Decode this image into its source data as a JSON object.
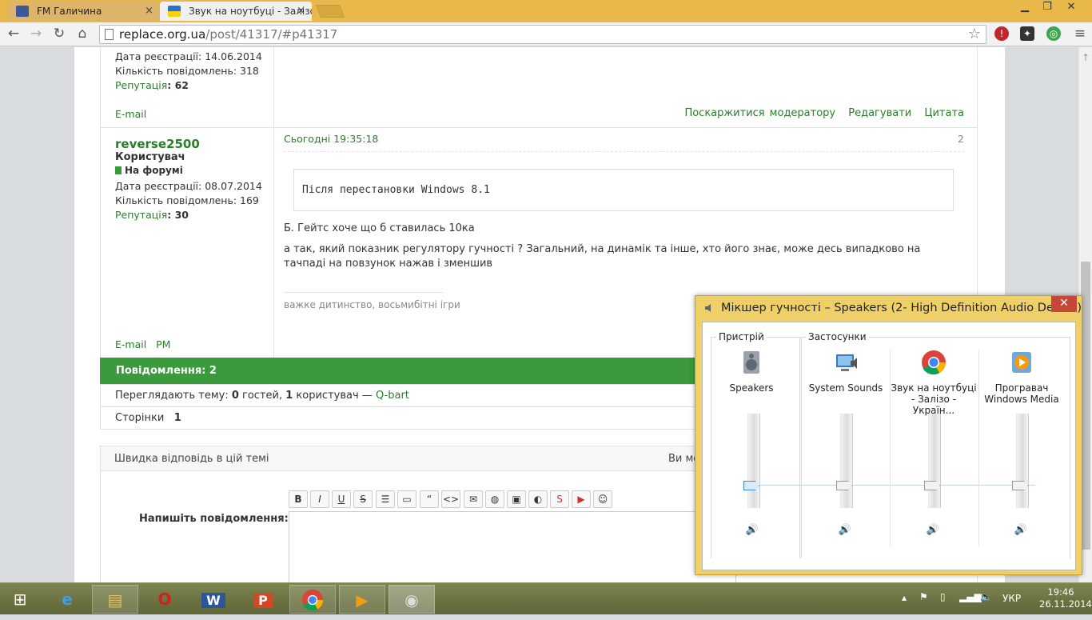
{
  "browser": {
    "tabs": [
      {
        "title": "FM Галичина",
        "close": "×"
      },
      {
        "title": "Звук на ноутбуці - Залізо",
        "close": "×"
      }
    ],
    "window_controls": {
      "minimize": "▁",
      "maximize": "❐",
      "close": "✕"
    },
    "nav": {
      "back": "←",
      "forward": "→",
      "reload": "↻",
      "home": "⌂"
    },
    "url_domain": "replace.org.ua",
    "url_path": "/post/41317/#p41317",
    "star": "☆",
    "menu": "≡"
  },
  "post_prev": {
    "reg_date_label": "Дата реєстрації:",
    "reg_date": "14.06.2014",
    "msg_count_label": "Кількість повідомлень:",
    "msg_count": "318",
    "reputation_label": "Репутація",
    "reputation": ": 62",
    "email": "E-mail",
    "actions": [
      "Поскаржитися модератору",
      "Редагувати",
      "Цитата"
    ]
  },
  "post": {
    "username": "reverse2500",
    "role": "Користувач",
    "status": "На форумі",
    "reg_date_label": "Дата реєстрації:",
    "reg_date": "08.07.2014",
    "msg_count_label": "Кількість повідомлень:",
    "msg_count": "169",
    "reputation_label": "Репутація",
    "reputation": ": 30",
    "email": "E-mail",
    "pm": "PM",
    "timestamp": "Сьогодні 19:35:18",
    "number": "2",
    "quote": "Після перестановки Windows 8.1",
    "line1": "Б. Гейтс хоче що б ставилась 10ка",
    "line2": "а так, який показник регулятору гучності ? Загальний, на динамік та інше, хто його знає, може десь випадково на тачпаді на повзунок нажав і зменшив",
    "signature": "важке дитинство, восьмибітні ігри"
  },
  "footer": {
    "messages": "Повідомлення: 2",
    "viewers_prefix": "Переглядають тему: ",
    "guests_count": "0",
    "guests_label": " гостей, ",
    "users_count": "1",
    "users_label": " користувач — ",
    "viewer_name": "Q-bart",
    "pages_label": "Сторінки",
    "pages_value": "1"
  },
  "quick_reply": {
    "title": "Швидка відповідь в цій темі",
    "right_text": "Ви мо",
    "label": "Напишіть повідомлення:",
    "toolbar": [
      "B",
      "I",
      "U",
      "S",
      "☰",
      "▭",
      "“",
      "<>",
      "✉",
      "◍",
      "▣",
      "◐",
      "S",
      "▶",
      "☺"
    ]
  },
  "mixer": {
    "title": "Мікшер гучності – Speakers (2- High Definition Audio Device)",
    "close": "✕",
    "device_group": "Пристрій",
    "apps_group": "Застосунки",
    "channels": [
      {
        "name": "Speakers",
        "level": 0.15,
        "selected": true
      },
      {
        "name": "System Sounds",
        "level": 0.15,
        "selected": false
      },
      {
        "name": "Звук на ноутбуці - Залізо - Україн...",
        "level": 0.15,
        "selected": false
      },
      {
        "name": "Програвач Windows Media",
        "level": 0.15,
        "selected": false
      }
    ],
    "mute_icon": "🔊"
  },
  "taskbar": {
    "language": "УКР",
    "time": "19:46",
    "date": "26.11.2014"
  }
}
